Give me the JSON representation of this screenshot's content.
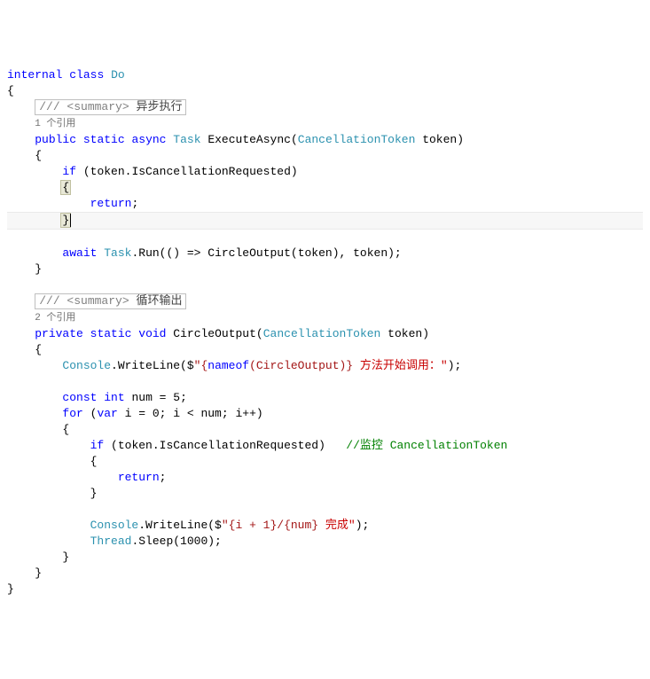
{
  "line1": {
    "kw_internal": "internal",
    "kw_class": "class",
    "cls": "Do"
  },
  "summary1": {
    "prefix": "/// <summary>",
    "text": "异步执行"
  },
  "refs1": "1 个引用",
  "sig1": {
    "public": "public",
    "static": "static",
    "async": "async",
    "task": "Task",
    "method": "ExecuteAsync",
    "ct": "CancellationToken",
    "param": "token"
  },
  "body1": {
    "if": "if",
    "cond": "(token.IsCancellationRequested)",
    "return": "return",
    "await": "await",
    "taskrun": "Task",
    "run": ".Run(() => CircleOutput(token), token);"
  },
  "summary2": {
    "prefix": "/// <summary>",
    "text": "循环输出"
  },
  "refs2": "2 个引用",
  "sig2": {
    "private": "private",
    "static": "static",
    "void": "void",
    "method": "CircleOutput",
    "ct": "CancellationToken",
    "param": "token"
  },
  "body2": {
    "console": "Console",
    "writeline": ".WriteLine($",
    "str1a": "\"{",
    "nameof": "nameof",
    "nameof_arg": "(CircleOutput)}",
    "str1b": " 方法开始调用：\"",
    "close1": ");",
    "const": "const",
    "int": "int",
    "numdecl": "num = 5;",
    "for": "for",
    "var": "var",
    "forrest": " i = 0; i < num; i++)",
    "if": "if",
    "cond": "(token.IsCancellationRequested)",
    "comment": "//监控 CancellationToken",
    "return": "return",
    "str2a": "\"{i + 1}/{num}",
    "str2b": " 完成\"",
    "close2": ");",
    "thread": "Thread",
    "sleep": ".Sleep(1000);"
  }
}
